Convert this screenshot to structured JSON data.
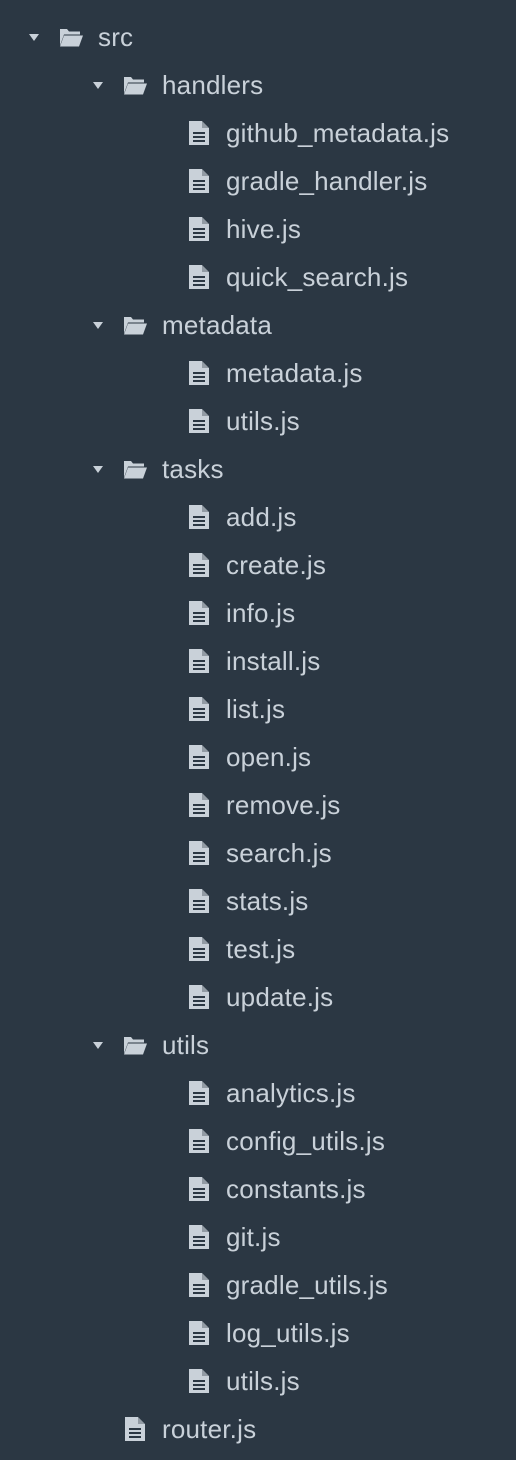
{
  "tree": {
    "root": {
      "label": "src",
      "icon": "folder-open-icon",
      "expanded": true,
      "folders": [
        {
          "label": "handlers",
          "icon": "folder-open-icon",
          "expanded": true,
          "files": [
            "github_metadata.js",
            "gradle_handler.js",
            "hive.js",
            "quick_search.js"
          ]
        },
        {
          "label": "metadata",
          "icon": "folder-open-icon",
          "expanded": true,
          "files": [
            "metadata.js",
            "utils.js"
          ]
        },
        {
          "label": "tasks",
          "icon": "folder-open-icon",
          "expanded": true,
          "files": [
            "add.js",
            "create.js",
            "info.js",
            "install.js",
            "list.js",
            "open.js",
            "remove.js",
            "search.js",
            "stats.js",
            "test.js",
            "update.js"
          ]
        },
        {
          "label": "utils",
          "icon": "folder-open-icon",
          "expanded": true,
          "files": [
            "analytics.js",
            "config_utils.js",
            "constants.js",
            "git.js",
            "gradle_utils.js",
            "log_utils.js",
            "utils.js"
          ]
        }
      ],
      "files": [
        "router.js"
      ]
    }
  },
  "colors": {
    "background": "#2b3743",
    "text": "#c9d1d9",
    "icon": "#c9d1d9"
  }
}
